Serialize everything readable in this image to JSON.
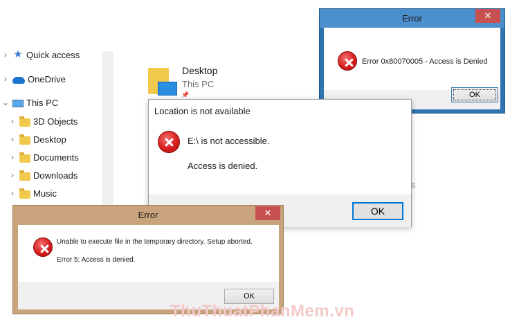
{
  "explorer": {
    "nav_items": [
      {
        "label": "Quick access",
        "icon": "star-icon",
        "chevron": "›"
      },
      {
        "label": "OneDrive",
        "icon": "cloud-icon",
        "chevron": "›"
      },
      {
        "label": "This PC",
        "icon": "computer-icon",
        "chevron": "⌄"
      },
      {
        "label": "3D Objects",
        "icon": "folder-icon",
        "chevron": "›"
      },
      {
        "label": "Desktop",
        "icon": "folder-icon",
        "chevron": "›"
      },
      {
        "label": "Documents",
        "icon": "folder-icon",
        "chevron": "›"
      },
      {
        "label": "Downloads",
        "icon": "folder-icon",
        "chevron": "›"
      },
      {
        "label": "Music",
        "icon": "folder-icon",
        "chevron": "›"
      }
    ],
    "content": {
      "item_name": "Desktop",
      "item_location": "This PC",
      "pin_glyph": "📌",
      "partial_text": "s"
    }
  },
  "dialog_blue": {
    "title": "Error",
    "close_glyph": "✕",
    "message": "Error 0x80070005 - Access is Denied",
    "ok_label": "OK"
  },
  "dialog_center": {
    "title": "Location is not available",
    "line1": "E:\\ is not accessible.",
    "line2": "Access is denied.",
    "ok_label": "OK"
  },
  "dialog_tan": {
    "title": "Error",
    "close_glyph": "✕",
    "line1": "Unable to execute file in the temporary directory. Setup aborted.",
    "line2": "Error 5: Access is denied.",
    "ok_label": "OK"
  },
  "watermark": "ThuThuatPhanMem.vn",
  "colors": {
    "accent_blue": "#0078d7",
    "error_red": "#d81e1e",
    "close_red": "#c75050",
    "frame_blue": "#2f73b0",
    "frame_tan": "#c9a37c"
  }
}
